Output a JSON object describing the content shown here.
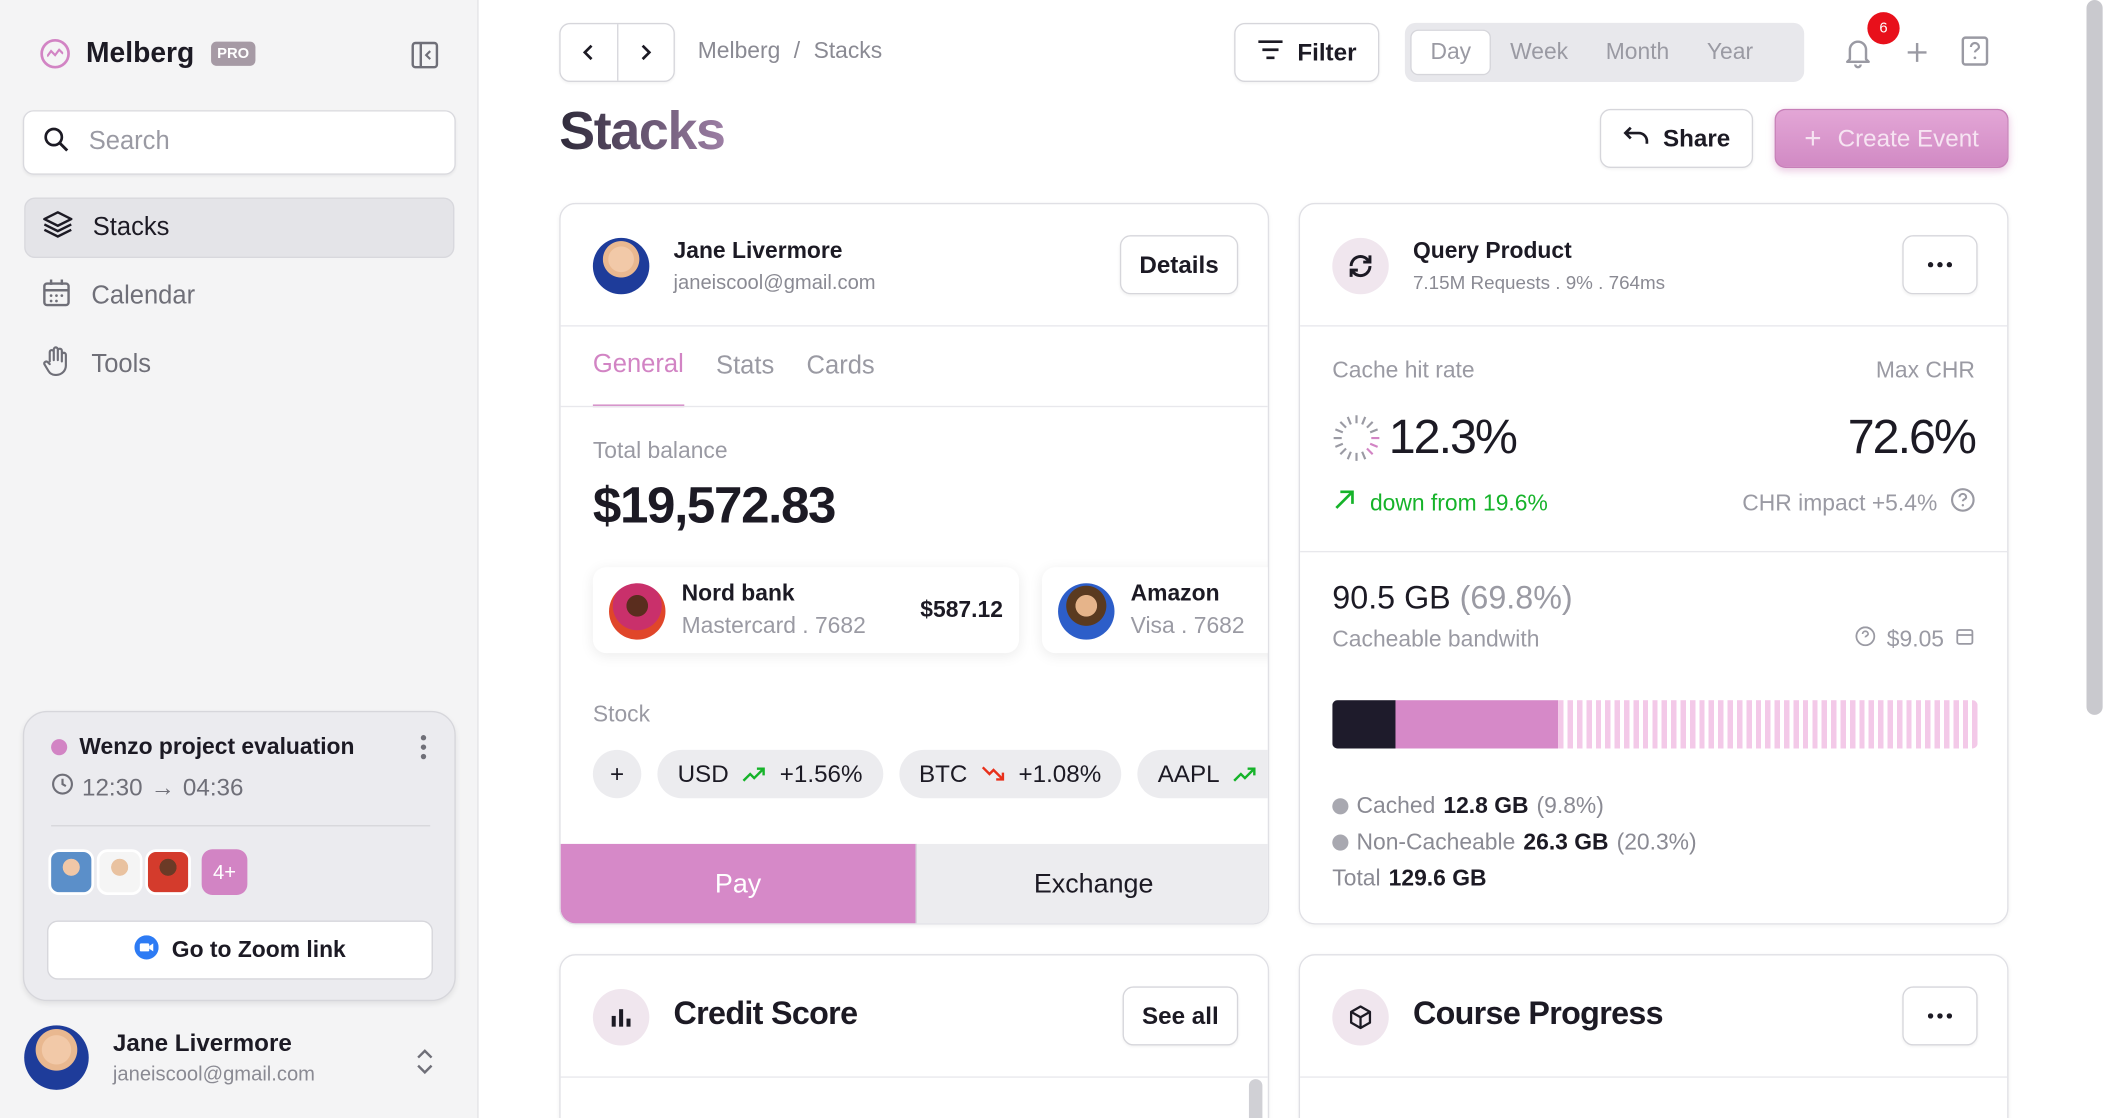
{
  "brand": {
    "name": "Melberg",
    "badge": "PRO",
    "accent": "#d284c4"
  },
  "search": {
    "placeholder": "Search"
  },
  "nav": [
    {
      "label": "Stacks",
      "icon": "layers-icon",
      "active": true
    },
    {
      "label": "Calendar",
      "icon": "calendar-icon"
    },
    {
      "label": "Tools",
      "icon": "hand-icon"
    }
  ],
  "event": {
    "title": "Wenzo project evaluation",
    "start": "12:30",
    "end": "04:36",
    "more_count": "4+",
    "zoom_label": "Go to Zoom link"
  },
  "user": {
    "name": "Jane Livermore",
    "email": "janeiscool@gmail.com"
  },
  "breadcrumb": [
    "Melberg",
    "/",
    "Stacks"
  ],
  "toolbar": {
    "filter_label": "Filter",
    "ranges": [
      "Day",
      "Week",
      "Month",
      "Year"
    ],
    "selected_range": "Day",
    "notifications": "6",
    "share_label": "Share",
    "create_label": "Create Event"
  },
  "page_title": "Stacks",
  "account_card": {
    "name": "Jane Livermore",
    "email": "janeiscool@gmail.com",
    "details_label": "Details",
    "tabs": [
      "General",
      "Stats",
      "Cards"
    ],
    "balance_label": "Total balance",
    "balance": "$19,572.83",
    "banks": [
      {
        "name": "Nord bank",
        "sub": "Mastercard . 7682",
        "amount": "$587.12"
      },
      {
        "name": "Amazon",
        "sub": "Visa . 7682",
        "amount": ""
      }
    ],
    "stock_label": "Stock",
    "stocks": [
      {
        "symbol": "USD",
        "change": "+1.56%",
        "trend": "up"
      },
      {
        "symbol": "BTC",
        "change": "+1.08%",
        "trend": "down"
      },
      {
        "symbol": "AAPL",
        "change": "+",
        "trend": "up"
      }
    ],
    "pay_label": "Pay",
    "exchange_label": "Exchange"
  },
  "query_card": {
    "title": "Query Product",
    "sub": "7.15M Requests . 9% . 764ms",
    "cache_label": "Cache hit rate",
    "max_label": "Max CHR",
    "cache_value": "12.3%",
    "max_value": "72.6%",
    "trend_text": "down from 19.6%",
    "impact_text": "CHR impact +5.4%",
    "bandwidth": "90.5 GB",
    "bandwidth_pct": "(69.8%)",
    "bandwidth_label": "Cacheable bandwith",
    "cost": "$9.05",
    "cached_label": "Cached",
    "cached_value": "12.8 GB",
    "cached_pct": "(9.8%)",
    "noncache_label": "Non-Cacheable",
    "noncache_value": "26.3 GB",
    "noncache_pct": "(20.3%)",
    "total_label": "Total",
    "total_value": "129.6 GB",
    "bar": {
      "dark": 0.098,
      "pink": 0.253
    }
  },
  "credit_card": {
    "title": "Credit Score",
    "see_all": "See all"
  },
  "course_card": {
    "title": "Course Progress"
  }
}
